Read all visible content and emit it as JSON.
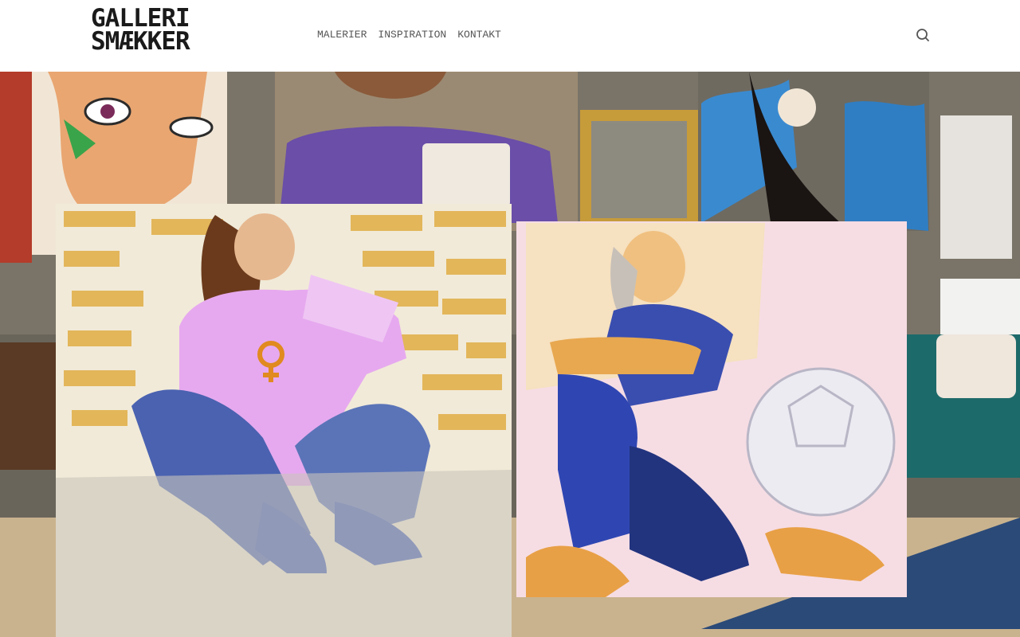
{
  "site": {
    "logo_line1": "GALLERI",
    "logo_line2": "SMÆKKER"
  },
  "nav": {
    "items": [
      {
        "label": "MALERIER"
      },
      {
        "label": "INSPIRATION"
      },
      {
        "label": "KONTAKT"
      }
    ]
  },
  "icons": {
    "search": "search-icon"
  },
  "colors": {
    "logo": "#1a1a1a",
    "nav_text": "#555555",
    "header_bg": "#ffffff"
  }
}
